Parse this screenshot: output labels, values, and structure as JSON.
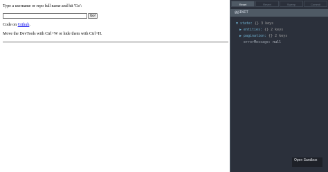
{
  "main": {
    "instruction": "Type a username or repo full name and hit 'Go':",
    "input_value": "",
    "go_label": "Go!",
    "code_on_prefix": "Code on ",
    "code_on_link": "Github",
    "code_on_suffix": ".",
    "devtools_hint": "Move the DevTools with Ctrl+W or hide them with Ctrl+H."
  },
  "devtools": {
    "buttons": [
      "Reset",
      "Revert",
      "Sweep",
      "Commit"
    ],
    "action": "@@INIT",
    "tree": {
      "state_key": "state",
      "state_val": "{} 3 keys",
      "entities_key": "entities",
      "entities_val": "{} 2 keys",
      "pagination_key": "pagination",
      "pagination_val": "{} 2 keys",
      "error_key": "errorMessage",
      "error_val": "null"
    },
    "open_sandbox": "Open Sandbox"
  },
  "colors": {
    "devtools_bg": "#2b303b",
    "key": "#6fb3d2",
    "link": "#0000ee"
  }
}
